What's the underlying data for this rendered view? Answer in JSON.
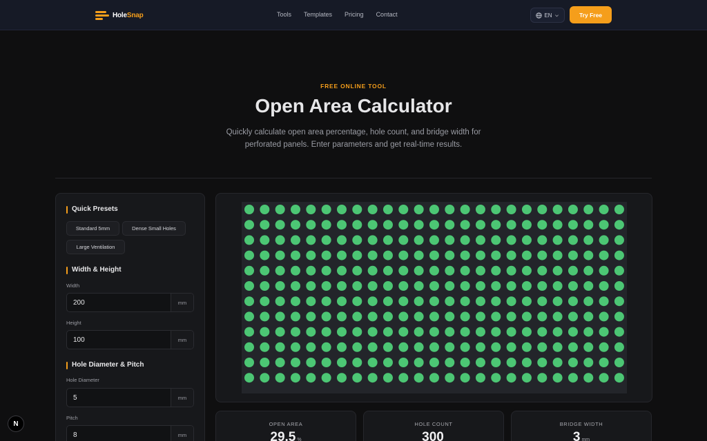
{
  "header": {
    "logo_main": "Hole",
    "logo_accent": "Snap",
    "nav": [
      "Tools",
      "Templates",
      "Pricing",
      "Contact"
    ],
    "language": "EN",
    "cta": "Try Free"
  },
  "hero": {
    "eyebrow": "FREE ONLINE TOOL",
    "title": "Open Area Calculator",
    "subtitle": "Quickly calculate open area percentage, hole count, and bridge width for perforated panels. Enter parameters and get real-time results."
  },
  "panel": {
    "presets_title": "Quick Presets",
    "presets": [
      "Standard 5mm",
      "Dense Small Holes",
      "Large Ventilation"
    ],
    "size_title": "Width & Height",
    "width_label": "Width",
    "width_value": "200",
    "height_label": "Height",
    "height_value": "100",
    "hole_title": "Hole Diameter & Pitch",
    "diameter_label": "Hole Diameter",
    "diameter_value": "5",
    "pitch_label": "Pitch",
    "pitch_value": "8",
    "unit": "mm"
  },
  "preview": {
    "columns": 25,
    "rows": 12,
    "hole_color": "#4cc674",
    "plate_color": "#23252a"
  },
  "stats": [
    {
      "label": "OPEN AREA",
      "value": "29.5",
      "unit": "%"
    },
    {
      "label": "HOLE COUNT",
      "value": "300",
      "unit": ""
    },
    {
      "label": "BRIDGE WIDTH",
      "value": "3",
      "unit": "mm"
    }
  ],
  "badge": "N"
}
